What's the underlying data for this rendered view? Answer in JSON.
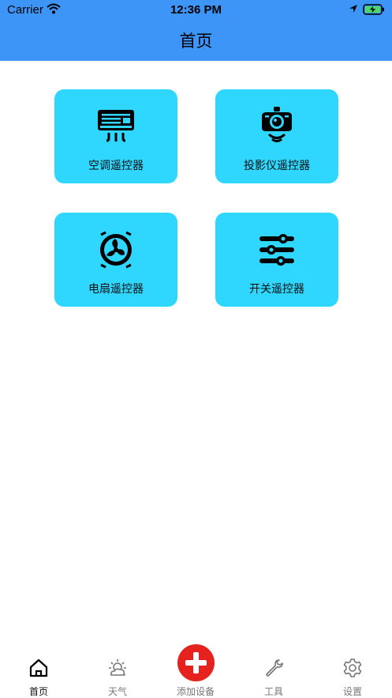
{
  "status_bar": {
    "carrier": "Carrier",
    "time": "12:36 PM"
  },
  "header": {
    "title": "首页"
  },
  "tiles": [
    {
      "label": "空调遥控器",
      "icon": "air-conditioner-icon"
    },
    {
      "label": "投影仪遥控器",
      "icon": "projector-icon"
    },
    {
      "label": "电扇遥控器",
      "icon": "fan-icon"
    },
    {
      "label": "开关遥控器",
      "icon": "switch-sliders-icon"
    }
  ],
  "tabbar": {
    "home": "首页",
    "weather": "天气",
    "add": "添加设备",
    "tools": "工具",
    "settings": "设置"
  },
  "colors": {
    "header": "#3d95f8",
    "tile": "#2fd6fd",
    "add_button": "#e5221d"
  }
}
